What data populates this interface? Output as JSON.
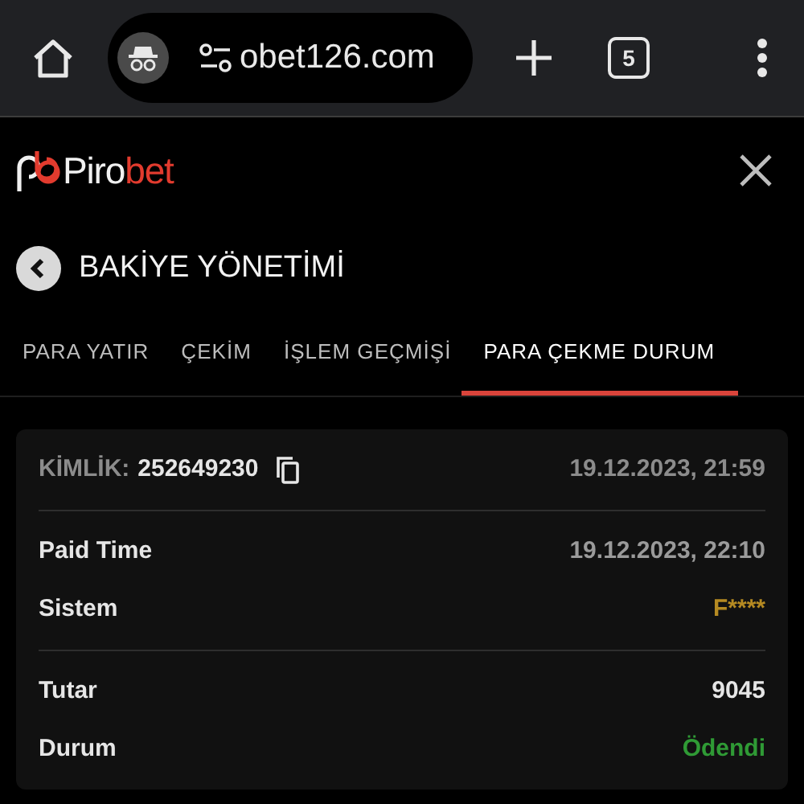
{
  "browser": {
    "url": "obet126.com",
    "tab_count": "5"
  },
  "logo": {
    "first": "Piro",
    "second": "bet"
  },
  "page_title": "BAKİYE YÖNETİMİ",
  "tabs": [
    {
      "label": "PARA YATIR",
      "selected": false
    },
    {
      "label": "ÇEKİM",
      "selected": false
    },
    {
      "label": "İŞLEM GEÇMİŞİ",
      "selected": false
    },
    {
      "label": "PARA ÇEKME DURUM",
      "selected": true
    }
  ],
  "card": {
    "id_label": "KİMLİK:",
    "id_value": "252649230",
    "created": "19.12.2023, 21:59",
    "groups": [
      [
        {
          "label": "Paid Time",
          "value": "19.12.2023, 22:10",
          "color": "#9a9a9a"
        },
        {
          "label": "Sistem",
          "value": "F****",
          "color": "#b58a22"
        }
      ],
      [
        {
          "label": "Tutar",
          "value": "9045",
          "color": "#e6e6e6"
        },
        {
          "label": "Durum",
          "value": "Ödendi",
          "color": "#2f9a35"
        }
      ]
    ]
  }
}
